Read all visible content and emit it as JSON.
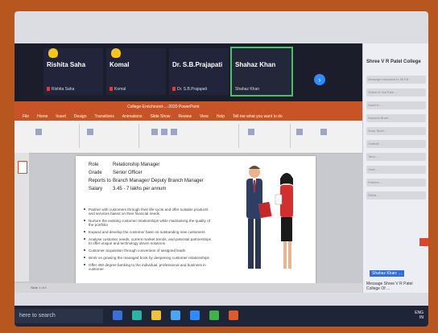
{
  "participants": [
    {
      "name": "Rishita Saha",
      "sub": "Rishita Saha",
      "hand": true
    },
    {
      "name": "Komal",
      "sub": "Komal",
      "hand": true
    },
    {
      "name": "Dr. S.B.Prajapati",
      "sub": "Dr. S.B.Prajapati",
      "hand": false
    },
    {
      "name": "Shahaz Khan",
      "sub": "Shahaz Khan",
      "hand": false,
      "active": true
    }
  ],
  "chat": {
    "title": "Shree V R Patel College",
    "lines": [
      "Message truncated to 96 KB",
      "Shanti N YouTube ...",
      "Aashi K: ...",
      "Kaushal Bhatt ...",
      "Sona Shah ...",
      "Chaitali ...",
      "Tanvi ...",
      "Yash ...",
      "Krishna ...",
      "Disha ..."
    ],
    "tag": "Shahaz Khan: ...",
    "footer": "Message Shree V R Patel College Of ..."
  },
  "ppt": {
    "title_bar": "College-Enrichment-...-2020 PowerPoint",
    "tabs": [
      "File",
      "Home",
      "Insert",
      "Design",
      "Transitions",
      "Animations",
      "Slide Show",
      "Review",
      "View",
      "Help",
      "Tell me what you want to do"
    ],
    "status": "Slide 1 of 1"
  },
  "slide": {
    "role_key": "Role",
    "role_val": "Relationship Manager",
    "grade_key": "Grade",
    "grade_val": "Senior Officer",
    "reports_key": "Reports to",
    "reports_val": "Branch Manager/ Deputy Branch Manager",
    "salary_key": "Salary",
    "salary_val": "3.45 - 7 lakhs per annum",
    "bullets": [
      "Partner with customers through their life-cycle and offer suitable products and services based on their financial needs",
      "Nurture the existing customer relationships while maintaining the quality of the portfolio",
      "Expand and develop the customer base on outstanding new customers",
      "Analyse customer needs, current market trends, and potential partnerships to offer unique and technology driven solutions",
      "Customer acquisition through conversion of assigned leads",
      "Work on growing the managed book by deepening customer relationships",
      "Offer 360 degree banking to the individual, professional and business in customer"
    ]
  },
  "taskbar": {
    "search": "here to search",
    "lang": "ENG",
    "region": "IN"
  }
}
